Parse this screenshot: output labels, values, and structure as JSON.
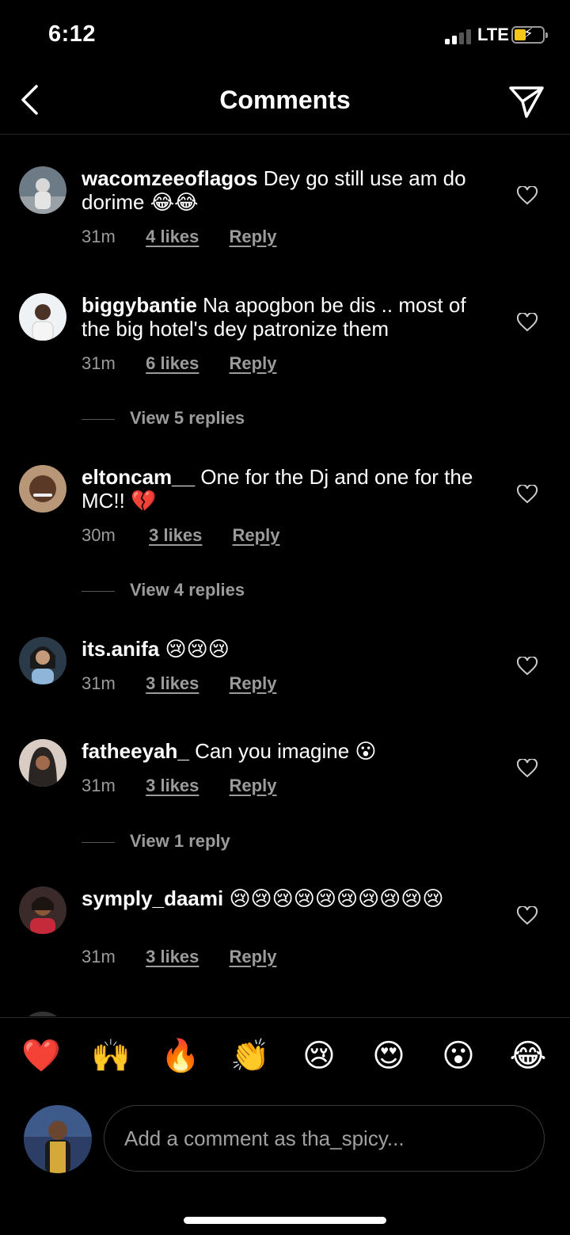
{
  "status": {
    "time": "6:12",
    "network": "LTE"
  },
  "header": {
    "title": "Comments"
  },
  "comments": [
    {
      "user": "wacomzeeoflagos",
      "text": "Dey go still use am do dorime 😂😂",
      "time": "31m",
      "likes": "4 likes",
      "reply": "Reply"
    },
    {
      "user": "biggybantie",
      "text": "Na apogbon be dis .. most of the big hotel's dey patronize them",
      "time": "31m",
      "likes": "6 likes",
      "reply": "Reply",
      "view_replies": "View 5 replies"
    },
    {
      "user": "eltoncam__",
      "text": "One for the Dj and one for the MC!! 💔",
      "time": "30m",
      "likes": "3 likes",
      "reply": "Reply",
      "view_replies": "View 4 replies"
    },
    {
      "user": "its.anifa",
      "text": "😢😢😢",
      "time": "31m",
      "likes": "3 likes",
      "reply": "Reply"
    },
    {
      "user": "fatheeyah_",
      "text": "Can you imagine 😮",
      "time": "31m",
      "likes": "3 likes",
      "reply": "Reply",
      "view_replies": "View 1 reply"
    },
    {
      "user": "symply_daami",
      "text": "😢😢😢😢😢😢😢😢😢😢",
      "time": "31m",
      "likes": "3 likes",
      "reply": "Reply"
    }
  ],
  "reactions": [
    "❤️",
    "🙌",
    "🔥",
    "👏",
    "😢",
    "😍",
    "😮",
    "😂"
  ],
  "composer": {
    "placeholder": "Add a comment as tha_spicy..."
  },
  "colors": {
    "background": "#000000",
    "text": "#ffffff",
    "muted": "#9b9b9b",
    "battery": "#f5c518"
  }
}
